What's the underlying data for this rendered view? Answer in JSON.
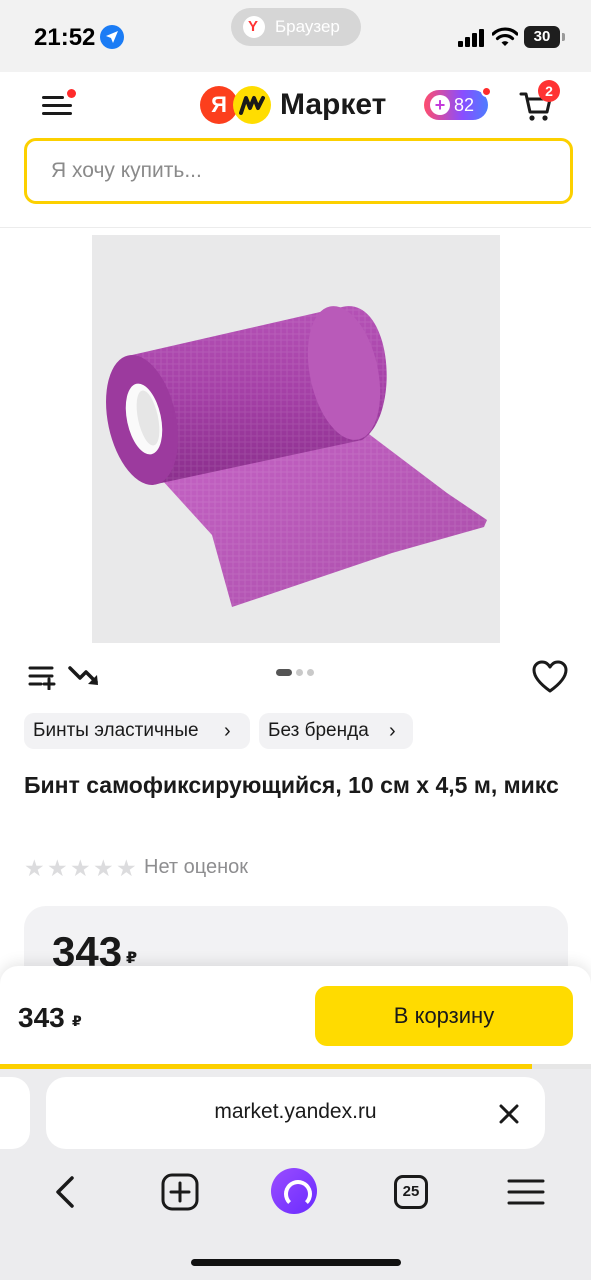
{
  "status_bar": {
    "time": "21:52",
    "browser_label": "Браузер",
    "battery": "30",
    "icons": [
      "location-arrow-icon",
      "signal-icon",
      "wifi-icon",
      "battery-icon"
    ]
  },
  "header": {
    "logo_letter": "Я",
    "logo_text": "Маркет",
    "plus_points": "82",
    "cart_count": "2",
    "colors": {
      "search_border": "#fcd000",
      "logo_red": "#fc3f1d",
      "logo_yellow": "#ffdd00",
      "badge_red": "#ff3333"
    }
  },
  "search": {
    "placeholder": "Я хочу купить...",
    "value": ""
  },
  "product": {
    "image_alt": "purple-bandage-roll",
    "carousel": {
      "total": 3,
      "active": 1
    },
    "chips": [
      {
        "label": "Бинты эластичные"
      },
      {
        "label": "Без бренда"
      }
    ],
    "title": "Бинт самофиксирующийся, 10 см х 4,5 м, микс",
    "rating": {
      "stars": 0,
      "max": 5,
      "text": "Нет оценок"
    },
    "price": "343",
    "currency": "₽"
  },
  "buy_bar": {
    "price": "343",
    "currency": "₽",
    "button_label": "В корзину",
    "page_load_progress": 0.9,
    "button_color": "#ffdb00"
  },
  "browser": {
    "url": "market.yandex.ru",
    "tab_count": "25",
    "nav_icons": [
      "back-icon",
      "new-tab-icon",
      "alice-icon",
      "tabs-icon",
      "menu-icon"
    ]
  }
}
